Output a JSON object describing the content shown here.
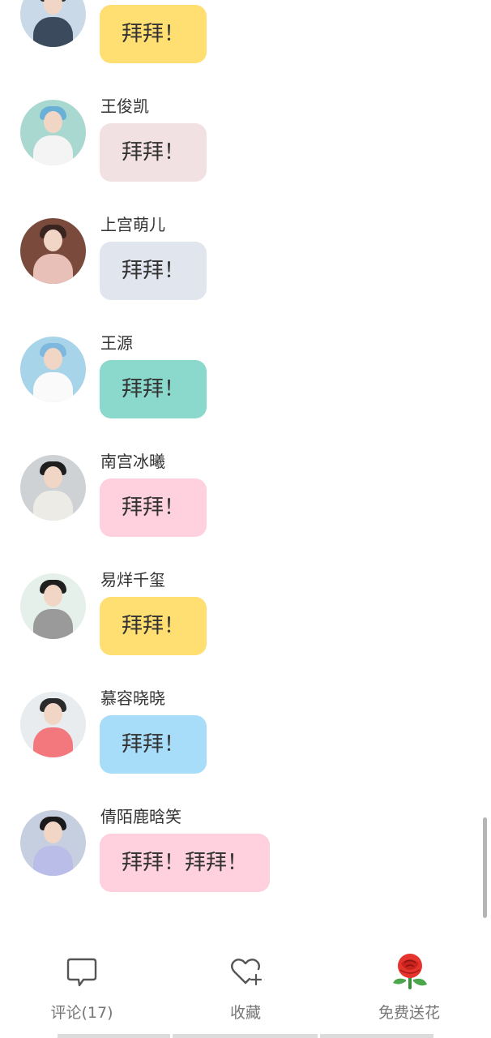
{
  "messages": [
    {
      "name": "",
      "text": "拜拜！",
      "bubble_color": "#FFDE72",
      "avatar_bg": "#c9d9e8",
      "hair": "#2b2b2b",
      "shirt": "#3b4a5c"
    },
    {
      "name": "王俊凯",
      "text": "拜拜！",
      "bubble_color": "#F2E1E3",
      "avatar_bg": "#a9d8d0",
      "hair": "#6ab0d6",
      "shirt": "#f4f4f4"
    },
    {
      "name": "上宫萌儿",
      "text": "拜拜！",
      "bubble_color": "#E1E6EE",
      "avatar_bg": "#7a4a3c",
      "hair": "#3a2420",
      "shirt": "#e8c0b8"
    },
    {
      "name": "王源",
      "text": "拜拜！",
      "bubble_color": "#8AD9CC",
      "avatar_bg": "#a8d4ea",
      "hair": "#7fb8de",
      "shirt": "#fafafa"
    },
    {
      "name": "南宫冰曦",
      "text": "拜拜！",
      "bubble_color": "#FFD1DE",
      "avatar_bg": "#cfd2d4",
      "hair": "#1e1e1e",
      "shirt": "#ecebe6"
    },
    {
      "name": "易烊千玺",
      "text": "拜拜！",
      "bubble_color": "#FFDE72",
      "avatar_bg": "#e6f0ea",
      "hair": "#1f1f1f",
      "shirt": "#9a9a9a"
    },
    {
      "name": "慕容晓晓",
      "text": "拜拜！",
      "bubble_color": "#A8DDFA",
      "avatar_bg": "#e9ecef",
      "hair": "#2a2a2a",
      "shirt": "#f2787e"
    },
    {
      "name": "倩陌鹿晗笑",
      "text": "拜拜！拜拜！",
      "bubble_color": "#FFD1DE",
      "avatar_bg": "#c6cfe0",
      "hair": "#1a1a1a",
      "shirt": "#b9bde8"
    }
  ],
  "tabbar": {
    "comment_label": "评论(17)",
    "favorite_label": "收藏",
    "flower_label": "免费送花",
    "comment_icon": "comment-bubble-icon",
    "favorite_icon": "heart-plus-icon",
    "flower_icon": "rose-icon",
    "rose_color": "#E5342D",
    "leaf_color": "#4CA64C"
  }
}
